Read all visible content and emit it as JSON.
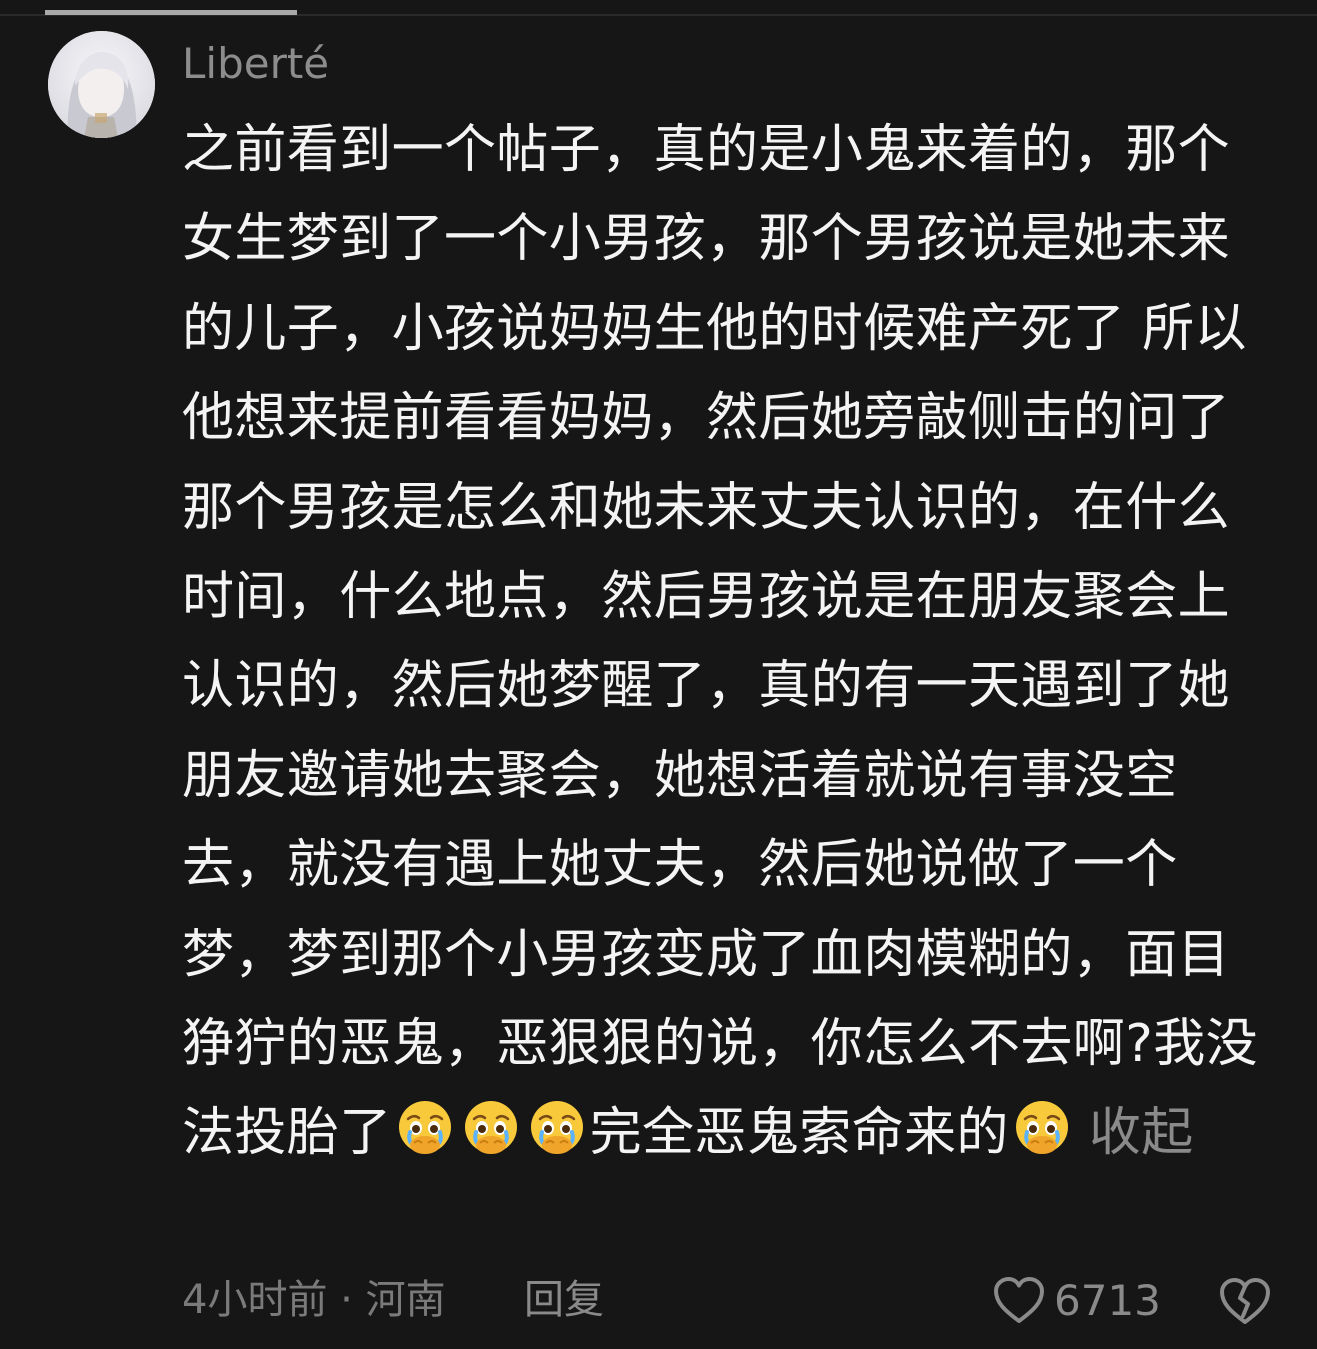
{
  "user": {
    "name": "Liberté"
  },
  "comment": {
    "text_part1": "之前看到一个帖子，真的是小鬼来着的，那个女生梦到了一个小男孩，那个男孩说是她未来的儿子，小孩说妈妈生他的时候难产死了 所以他想来提前看看妈妈，然后她旁敲侧击的问了那个男孩是怎么和她未来丈夫认识的，在什么时间，什么地点，然后男孩说是在朋友聚会上认识的，然后她梦醒了，真的有一天遇到了她朋友邀请她去聚会，她想活着就说有事没空去，就没有遇上她丈夫，然后她说做了一个梦，梦到那个小男孩变成了血肉模糊的，面目狰狞的恶鬼，恶狠狠的说，你怎么不去啊?我没法投胎了",
    "text_part2": "完全恶鬼索命来的",
    "emoji_name": "crying-face-emoji",
    "collapse_label": "收起"
  },
  "meta": {
    "time_location": "4小时前 · 河南",
    "reply_label": "回复",
    "like_count": "6713"
  },
  "icons": {
    "like": "heart-outline-icon",
    "dislike": "broken-heart-icon"
  },
  "colors": {
    "background": "#161616",
    "text": "#f4f4f4",
    "muted": "#8a8a8a"
  }
}
